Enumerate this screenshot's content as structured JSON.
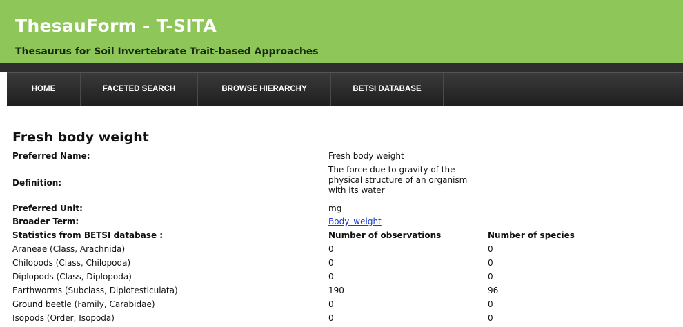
{
  "header": {
    "title": "ThesauForm - T-SITA",
    "subtitle": "Thesaurus for Soil Invertebrate Trait-based Approaches"
  },
  "nav": {
    "items": [
      {
        "label": "HOME"
      },
      {
        "label": "FACETED SEARCH"
      },
      {
        "label": "BROWSE HIERARCHY"
      },
      {
        "label": "BETSI DATABASE"
      }
    ]
  },
  "colors": {
    "header_bg": "#8fc65a",
    "nav_bg": "#2b2b2b",
    "link": "#1a3cc8"
  },
  "page": {
    "title": "Fresh body weight",
    "preferred_name_label": "Preferred Name:",
    "preferred_name_value": "Fresh body weight",
    "definition_label": "Definition:",
    "definition_value": "The force due to gravity of the physical structure of an organism with its water",
    "preferred_unit_label": "Preferred Unit:",
    "preferred_unit_value": "mg",
    "broader_term_label": "Broader Term:",
    "broader_term_value": "Body_weight",
    "stats_label": "Statistics from BETSI database :",
    "col_observations": "Number of observations",
    "col_species": "Number of species"
  },
  "stats": {
    "rows": [
      {
        "taxon": "Araneae (Class, Arachnida)",
        "observations": "0",
        "species": "0"
      },
      {
        "taxon": "Chilopods (Class, Chilopoda)",
        "observations": "0",
        "species": "0"
      },
      {
        "taxon": "Diplopods (Class, Diplopoda)",
        "observations": "0",
        "species": "0"
      },
      {
        "taxon": "Earthworms (Subclass, Diplotesticulata)",
        "observations": "190",
        "species": "96"
      },
      {
        "taxon": "Ground beetle (Family, Carabidae)",
        "observations": "0",
        "species": "0"
      },
      {
        "taxon": "Isopods (Order, Isopoda)",
        "observations": "0",
        "species": "0"
      }
    ]
  }
}
